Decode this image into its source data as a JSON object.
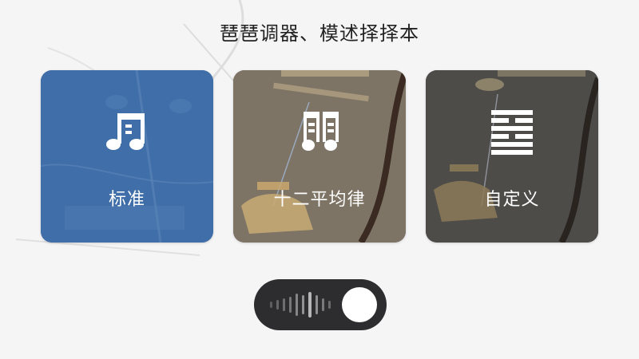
{
  "title": "琶琶调器、模述择择本",
  "cards": [
    {
      "label": "标准",
      "icon": "music-note-icon",
      "color": "#3f6ea8"
    },
    {
      "label": "十二平均律",
      "icon": "twelve-tone-notes-icon",
      "color": "#7a7062"
    },
    {
      "label": "自定义",
      "icon": "hexagram-icon",
      "color": "#4a4a48"
    }
  ],
  "toggle": {
    "icon": "sound-wave-icon",
    "state": "off"
  }
}
